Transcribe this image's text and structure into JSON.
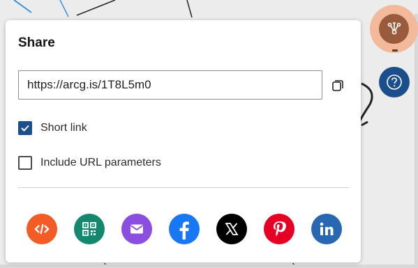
{
  "panel": {
    "title": "Share",
    "url_value": "https://arcg.is/1T8L5m0",
    "short_link": {
      "label": "Short link",
      "checked": true
    },
    "url_params": {
      "label": "Include URL parameters",
      "checked": false
    }
  },
  "social_buttons": [
    {
      "name": "embed-button",
      "icon": "code-icon",
      "color": "#f35c25"
    },
    {
      "name": "qr-code-button",
      "icon": "qr-code-icon",
      "color": "#13886f"
    },
    {
      "name": "email-button",
      "icon": "envelope-icon",
      "color": "#8a4ee0"
    },
    {
      "name": "facebook-button",
      "icon": "facebook-icon",
      "color": "#1877f2"
    },
    {
      "name": "x-button",
      "icon": "x-logo-icon",
      "color": "#000000"
    },
    {
      "name": "pinterest-button",
      "icon": "pinterest-icon",
      "color": "#e60023"
    },
    {
      "name": "linkedin-button",
      "icon": "linkedin-icon",
      "color": "#2867b2"
    }
  ],
  "colors": {
    "accent": "#1b4f8c",
    "share_ring": "#f2b99a",
    "share_fill": "#9a5b3c"
  }
}
